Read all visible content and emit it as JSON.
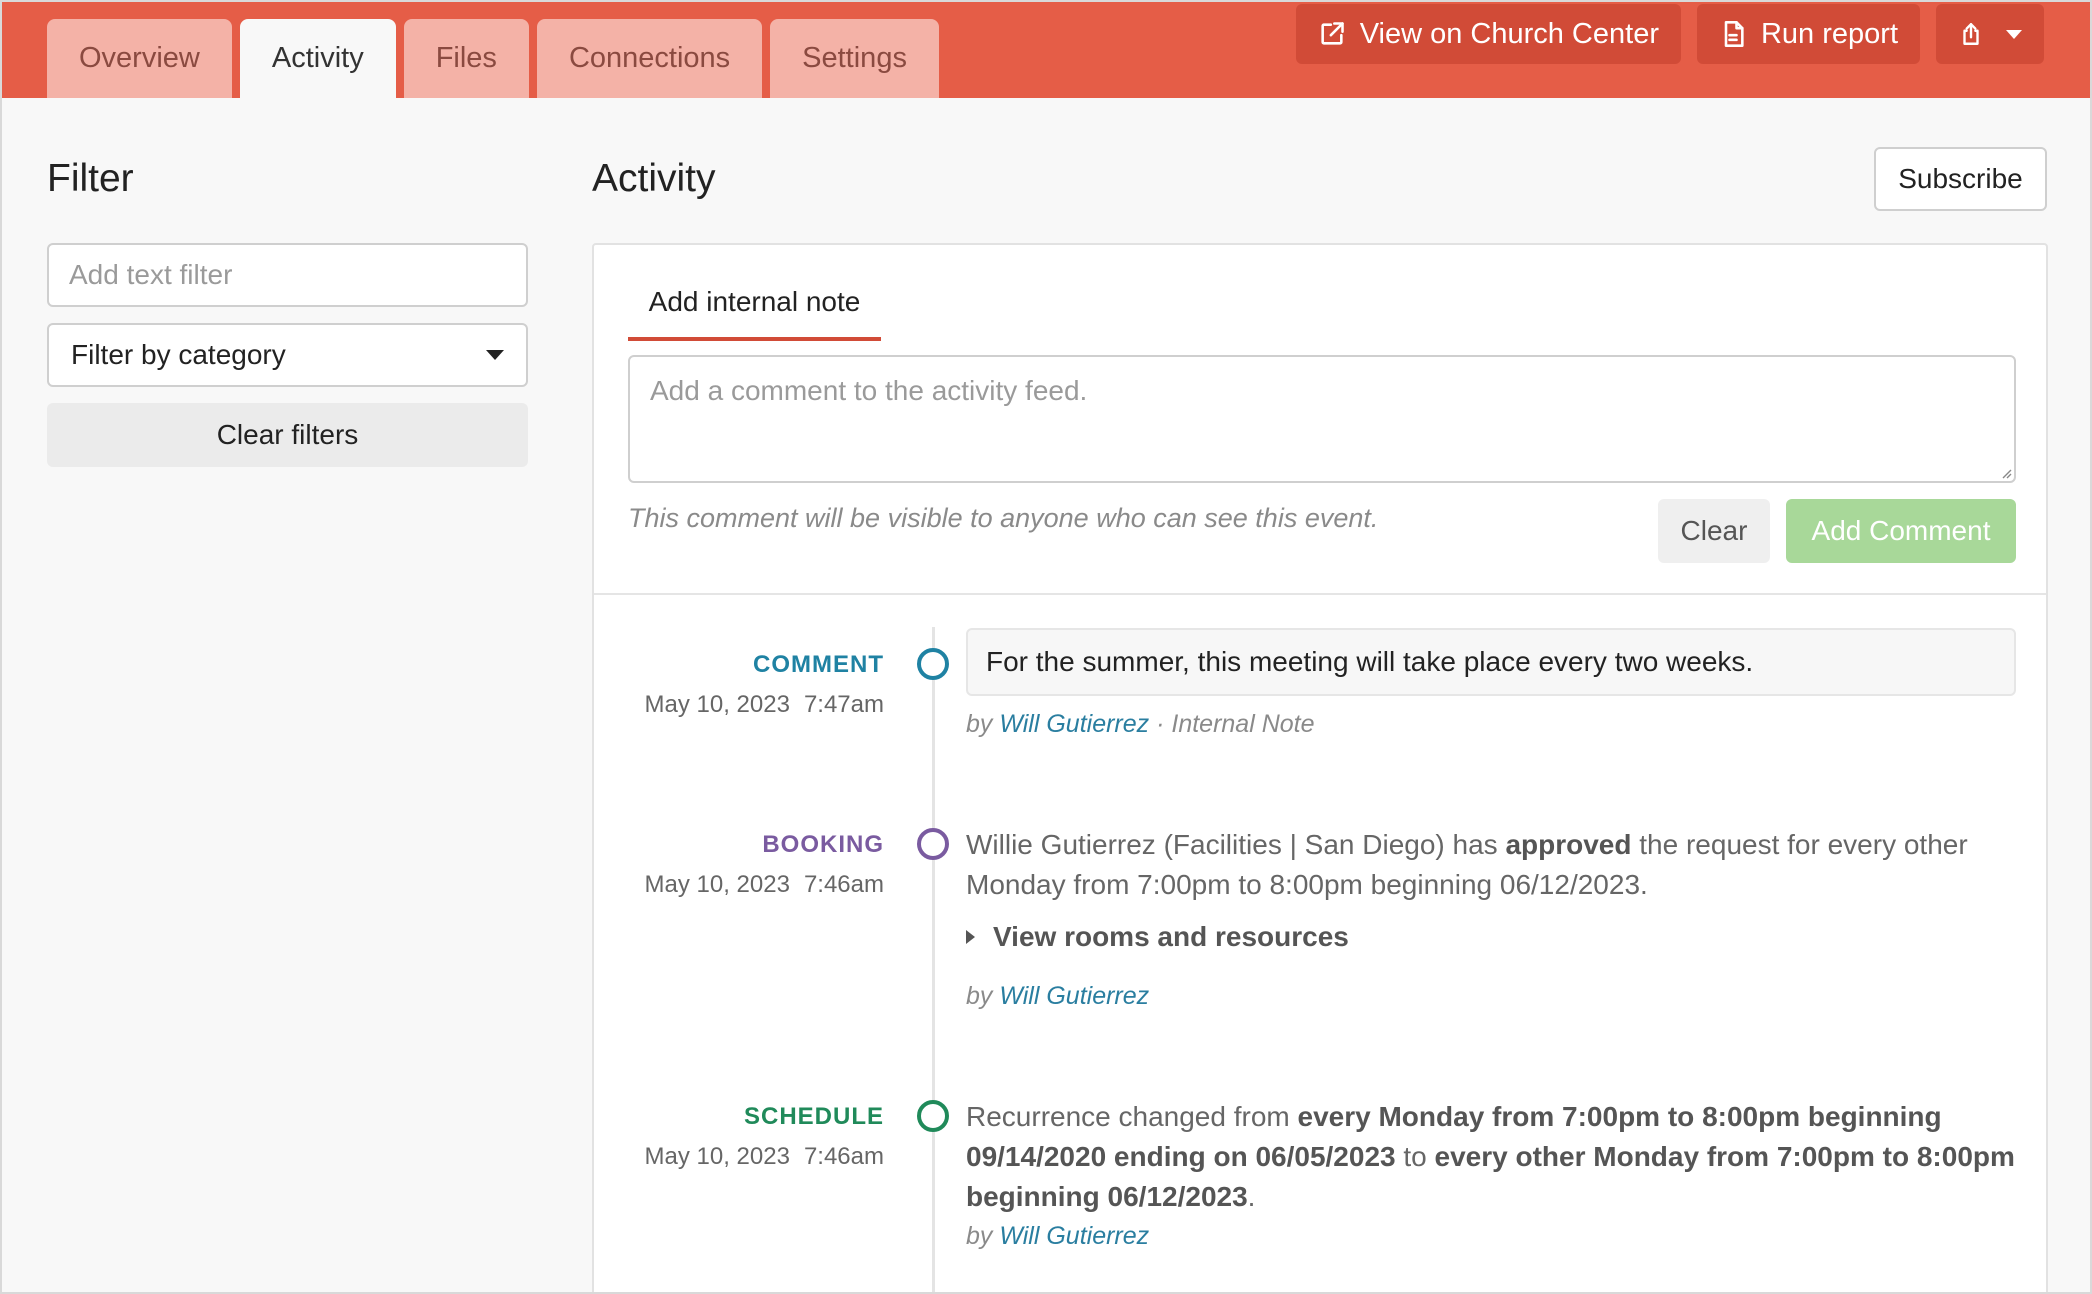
{
  "tabs": [
    {
      "label": "Overview",
      "active": false
    },
    {
      "label": "Activity",
      "active": true
    },
    {
      "label": "Files",
      "active": false
    },
    {
      "label": "Connections",
      "active": false
    },
    {
      "label": "Settings",
      "active": false
    }
  ],
  "actions": {
    "view_church_center": "View on Church Center",
    "run_report": "Run report"
  },
  "sidebar": {
    "title": "Filter",
    "text_filter_placeholder": "Add text filter",
    "category_select": "Filter by category",
    "clear_filters": "Clear filters"
  },
  "main": {
    "title": "Activity",
    "subscribe": "Subscribe",
    "note_tab": "Add internal note",
    "comment_placeholder": "Add a comment to the activity feed.",
    "visibility_note": "This comment will be visible to anyone who can see this event.",
    "clear": "Clear",
    "add_comment": "Add Comment"
  },
  "entries": {
    "comment": {
      "category": "COMMENT",
      "date": "May 10, 2023",
      "time": "7:47am",
      "text": "For the summer, this meeting will take place every two weeks.",
      "by": "by",
      "user": "Will Gutierrez",
      "suffix": "· Internal Note"
    },
    "booking": {
      "category": "BOOKING",
      "date": "May 10, 2023",
      "time": "7:46am",
      "text_a": "Willie Gutierrez (Facilities | San Diego) has",
      "text_bold": "approved",
      "text_b": "the request for every other Monday from 7:00pm to 8:00pm beginning 06/12/2023.",
      "expander": "View rooms and resources",
      "by": "by",
      "user": "Will Gutierrez"
    },
    "schedule": {
      "category": "SCHEDULE",
      "date": "May 10, 2023",
      "time": "7:46am",
      "text_a": "Recurrence changed from",
      "text_from": "every Monday from 7:00pm to 8:00pm beginning 09/14/2020 ending on 06/05/2023",
      "text_to_word": "to",
      "text_to": "every other Monday from 7:00pm to 8:00pm beginning 06/12/2023",
      "text_end": ".",
      "by": "by",
      "user": "Will Gutierrez"
    }
  },
  "colors": {
    "header": "#e55d47",
    "comment": "#1f82a3",
    "booking": "#7a5ba0",
    "schedule": "#208a5a",
    "add_comment_bg": "#a8d899"
  }
}
